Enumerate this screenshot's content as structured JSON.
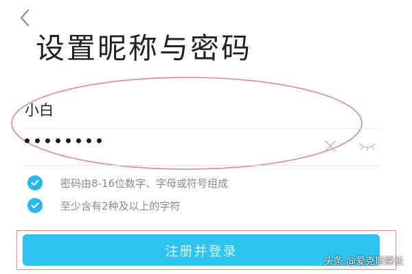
{
  "header": {
    "back_icon": "chevron-left-icon",
    "title": "设置昵称与密码"
  },
  "form": {
    "nickname_value": "小白",
    "password_mask_length": 8,
    "clear_icon": "clear-x-icon",
    "toggle_visibility_icon": "eye-closed-icon"
  },
  "rules": [
    {
      "text": "密码由8-16位数字、字母或符号组成",
      "checked": true
    },
    {
      "text": "至少含有2种及以上的字符",
      "checked": true
    }
  ],
  "submit": {
    "label": "注册并登录"
  },
  "watermark": {
    "text": "头条 @爱克斯探长"
  },
  "colors": {
    "accent": "#2fc4f0",
    "check": "#2ab8ec",
    "annotation": "#d98a8a"
  }
}
